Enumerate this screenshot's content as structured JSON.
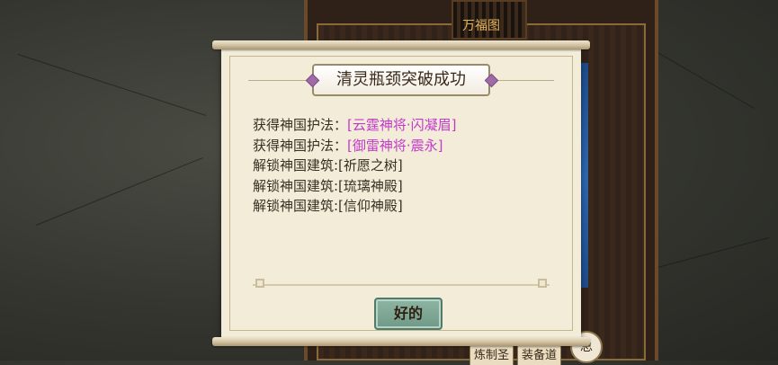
{
  "background": {
    "map_title": "万福图",
    "tabs": [
      "炼制圣",
      "装备道"
    ],
    "round_button_label": "总"
  },
  "dialog": {
    "title": "清灵瓶颈突破成功",
    "rewards": [
      {
        "prefix": "获得神国护法：",
        "highlight": "[云霆神将·闪凝眉]"
      },
      {
        "prefix": "获得神国护法：",
        "highlight": "[御雷神将·震永]"
      },
      {
        "prefix": "解锁神国建筑:[祈愿之树]",
        "highlight": ""
      },
      {
        "prefix": "解锁神国建筑:[琉璃神殿]",
        "highlight": ""
      },
      {
        "prefix": "解锁神国建筑:[信仰神殿]",
        "highlight": ""
      }
    ],
    "ok_button": "好的"
  },
  "colors": {
    "highlight": "#c23ac8",
    "button": "#7aa593",
    "paper": "#f3ecd9"
  }
}
